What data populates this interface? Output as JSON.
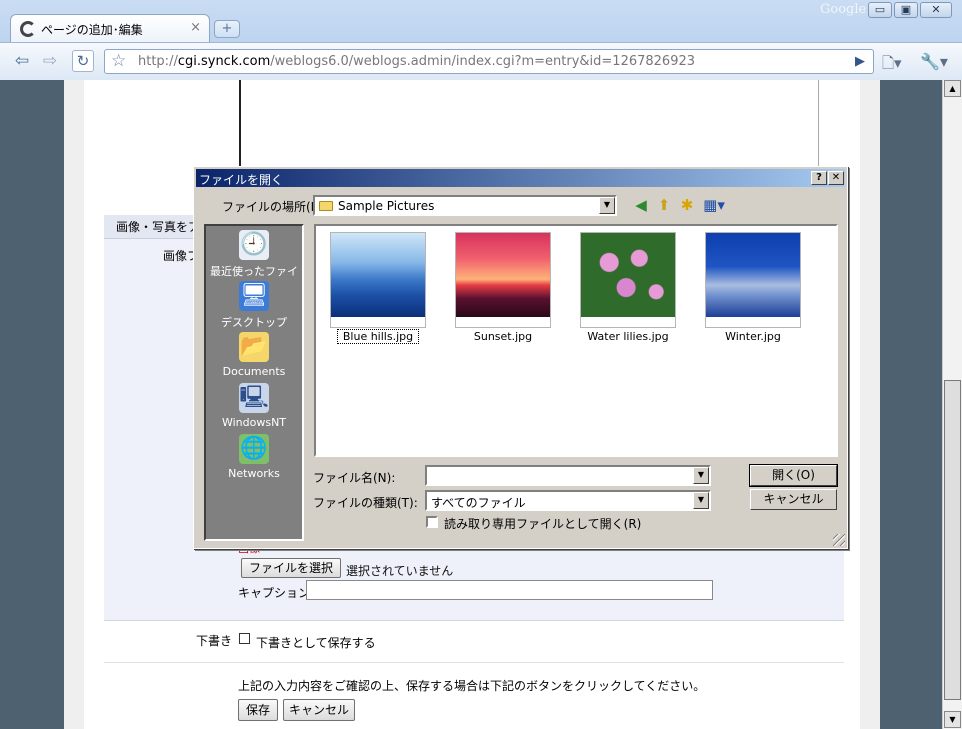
{
  "browser": {
    "tab_title": "ページの追加･編集",
    "tab_close": "×",
    "new_tab": "+",
    "brand": "Google",
    "window_buttons": {
      "minimize": "▭",
      "maximize": "▣",
      "close": "✕"
    },
    "nav": {
      "back": "⇦",
      "forward": "⇨",
      "reload": "↻",
      "star": "☆",
      "go": "▶",
      "page_menu": "🗋▾",
      "wrench_menu": "🔧▾"
    },
    "url_prefix": "http://",
    "url_host": "cgi.synck.com",
    "url_rest": "/weblogs6.0/weblogs.admin/index.cgi?m=entry&id=1267826923"
  },
  "page": {
    "section_heading": "画像・写真をア",
    "image_label": "画像フ",
    "required_mark": "画像*",
    "choose_file_button": "ファイルを選択",
    "no_file_selected": "選択されていません",
    "caption_label": "キャプション",
    "caption_value": "",
    "draft_label": "下書き",
    "draft_option": "下書きとして保存する",
    "notice": "上記の入力内容をご確認の上、保存する場合は下記のボタンをクリックしてください。",
    "save_button": "保存",
    "cancel_button": "キャンセル"
  },
  "scrollbar": {
    "up": "▲",
    "down": "▼"
  },
  "dialog": {
    "title": "ファイルを開く",
    "help": "?",
    "close": "✕",
    "look_in_label": "ファイルの場所(I):",
    "look_in_value": "Sample Pictures",
    "places": [
      {
        "label": "最近使ったファイル",
        "icon": "recent-files-icon",
        "glyph": "🕘"
      },
      {
        "label": "デスクトップ",
        "icon": "desktop-icon",
        "glyph": "🖥"
      },
      {
        "label": "Documents",
        "icon": "documents-folder-icon",
        "glyph": "📂"
      },
      {
        "label": "WindowsNT",
        "icon": "computer-icon",
        "glyph": "🖳"
      },
      {
        "label": "Networks",
        "icon": "network-icon",
        "glyph": "🌐"
      }
    ],
    "files": [
      {
        "name": "Blue hills.jpg",
        "selected": true
      },
      {
        "name": "Sunset.jpg",
        "selected": false
      },
      {
        "name": "Water lilies.jpg",
        "selected": false
      },
      {
        "name": "Winter.jpg",
        "selected": false
      }
    ],
    "file_name_label": "ファイル名(N):",
    "file_name_value": "",
    "file_type_label": "ファイルの種類(T):",
    "file_type_value": "すべてのファイル",
    "readonly_option": "読み取り専用ファイルとして開く(R)",
    "open_button": "開く(O)",
    "cancel_button": "キャンセル",
    "toolbar_icons": {
      "back": "◀",
      "up": "⬆",
      "new_folder": "✱",
      "view_menu": "▦▾"
    }
  }
}
